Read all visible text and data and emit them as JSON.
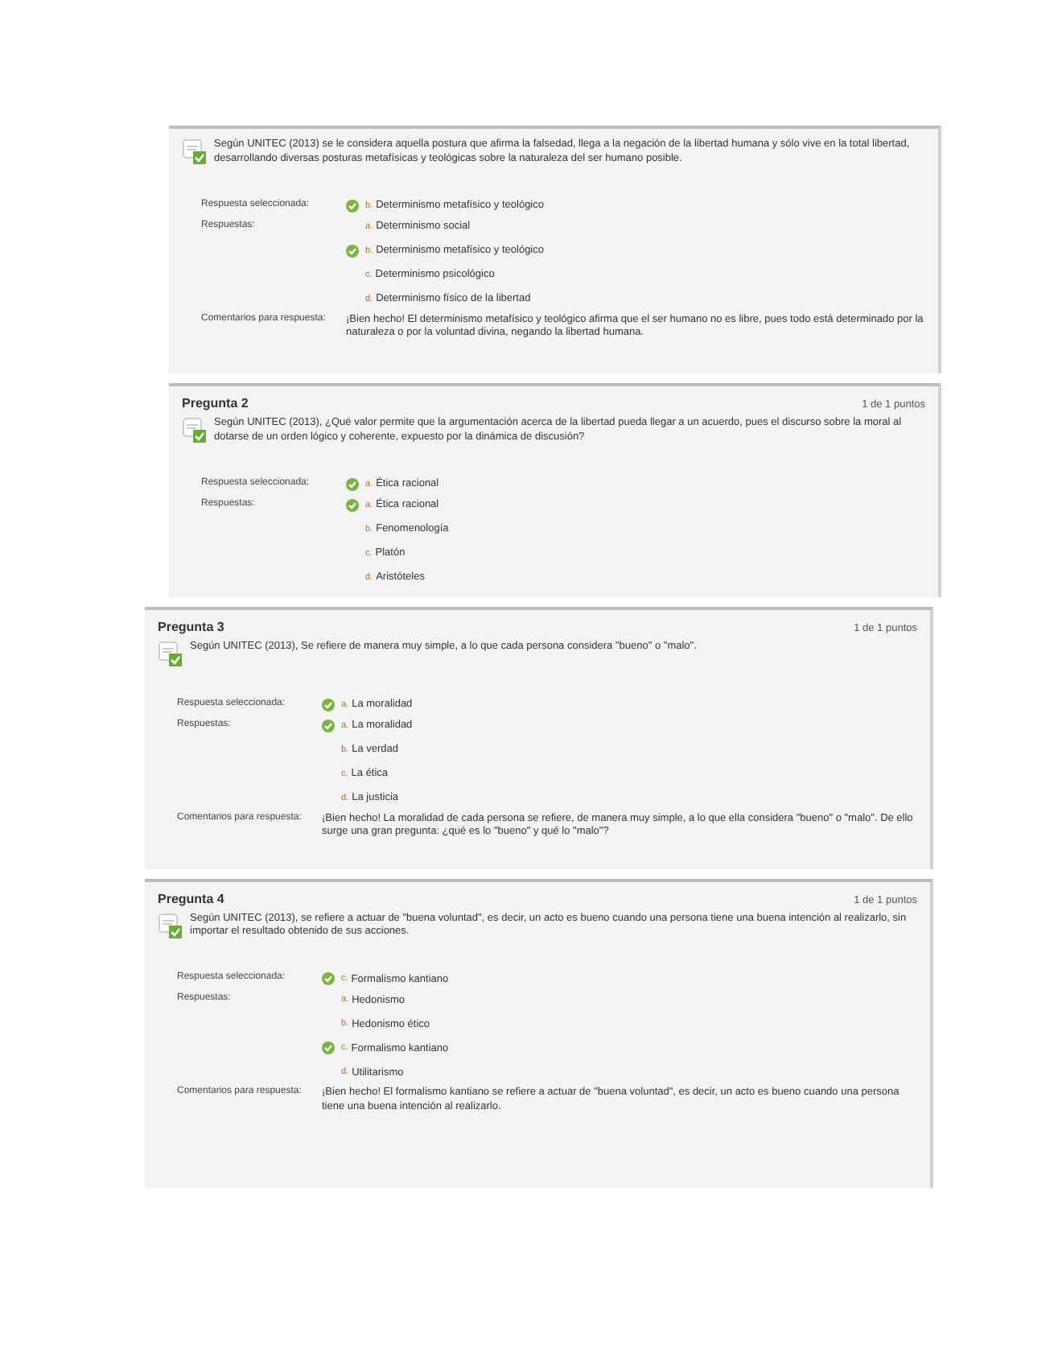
{
  "questions": [
    {
      "labels": {
        "selected": "Respuesta seleccionada:",
        "answers": "Respuestas:",
        "comment": "Comentarios para respuesta:"
      },
      "question": "Según UNITEC (2013) se le considera aquella postura que afirma la falsedad, llega a la negación de la libertad humana y sólo vive en la total libertad, desarrollando diversas posturas metafísicas y teológicas sobre la naturaleza del ser humano posible.",
      "selected": {
        "letter": "b.",
        "text": "Determinismo metafísico y teológico"
      },
      "answers": [
        {
          "letter": "a.",
          "text": "Determinismo social",
          "correct": false
        },
        {
          "letter": "b.",
          "text": "Determinismo metafísico y teológico",
          "correct": true
        },
        {
          "letter": "c.",
          "text": "Determinismo psicológico",
          "correct": false
        },
        {
          "letter": "d.",
          "text": "Determinismo físico de la libertad",
          "correct": false
        }
      ],
      "comment": "¡Bien hecho! El determinismo metafísico y teológico afirma que el ser humano no es libre, pues todo está determinado por la naturaleza o por la voluntad divina, negando la libertad humana."
    },
    {
      "labels": {
        "selected": "Respuesta seleccionada:",
        "answers": "Respuestas:"
      },
      "title": "Pregunta 2",
      "points": "1 de 1 puntos",
      "question": "Según UNITEC (2013), ¿Qué valor permite que la argumentación acerca de la libertad pueda llegar a un acuerdo, pues el discurso sobre la moral al dotarse de un orden lógico y coherente, expuesto por la dinámica de discusión?",
      "selected": {
        "letter": "a.",
        "text": "Ética racional"
      },
      "answers": [
        {
          "letter": "a.",
          "text": "Ética racional",
          "correct": true
        },
        {
          "letter": "b.",
          "text": "Fenomenología",
          "correct": false
        },
        {
          "letter": "c.",
          "text": "Platón",
          "correct": false
        },
        {
          "letter": "d.",
          "text": "Aristóteles",
          "correct": false
        }
      ]
    },
    {
      "labels": {
        "selected": "Respuesta seleccionada:",
        "answers": "Respuestas:",
        "comment": "Comentarios para respuesta:"
      },
      "title": "Pregunta 3",
      "points": "1 de 1 puntos",
      "question": "Según UNITEC (2013), Se refiere de manera muy simple, a lo que cada persona considera \"bueno\" o \"malo\".",
      "selected": {
        "letter": "a.",
        "text": "La moralidad"
      },
      "answers": [
        {
          "letter": "a.",
          "text": "La moralidad",
          "correct": true
        },
        {
          "letter": "b.",
          "text": "La verdad",
          "correct": false
        },
        {
          "letter": "c.",
          "text": "La ética",
          "correct": false
        },
        {
          "letter": "d.",
          "text": "La justicia",
          "correct": false
        }
      ],
      "comment": "¡Bien hecho! La moralidad de cada persona se refiere, de manera muy simple, a lo que ella considera \"bueno\" o \"malo\". De ello surge una gran pregunta: ¿qué es lo \"bueno\" y qué lo \"malo\"?"
    },
    {
      "labels": {
        "selected": "Respuesta seleccionada:",
        "answers": "Respuestas:",
        "comment": "Comentarios para respuesta:"
      },
      "title": "Pregunta 4",
      "points": "1 de 1 puntos",
      "question": "Según UNITEC (2013), se refiere a actuar de \"buena voluntad\", es decir, un acto es bueno cuando una persona tiene una buena intención al realizarlo, sin importar el resultado obtenido de sus acciones.",
      "selected": {
        "letter": "c.",
        "text": "Formalismo kantiano"
      },
      "answers": [
        {
          "letter": "a.",
          "text": "Hedonismo",
          "correct": false
        },
        {
          "letter": "b.",
          "text": "Hedonismo ético",
          "correct": false
        },
        {
          "letter": "c.",
          "text": "Formalismo kantiano",
          "correct": true
        },
        {
          "letter": "d.",
          "text": "Utilitarismo",
          "correct": false
        }
      ],
      "comment": "¡Bien hecho! El formalismo kantiano se refiere a actuar de \"buena voluntad\", es decir, un acto es bueno cuando una persona tiene una buena intención al realizarlo."
    }
  ]
}
